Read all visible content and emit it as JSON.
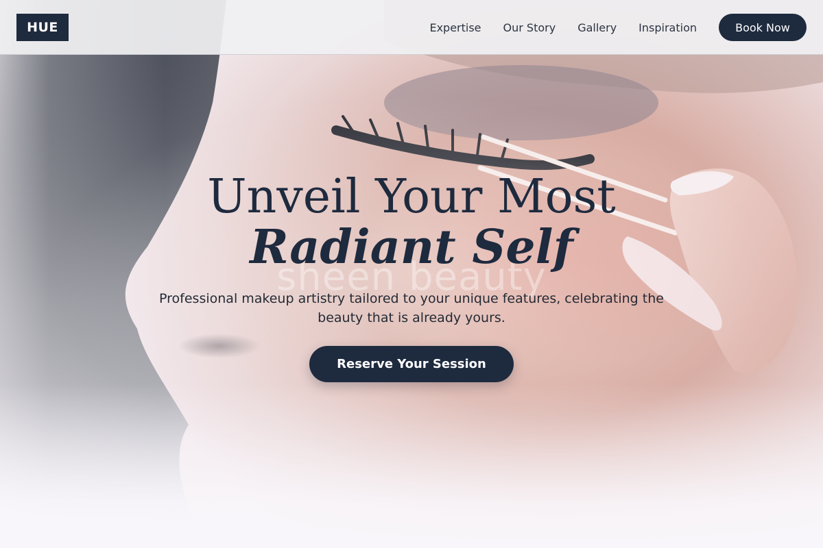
{
  "header": {
    "logo_text": "HUE",
    "nav": [
      "Expertise",
      "Our Story",
      "Gallery",
      "Inspiration"
    ],
    "book_label": "Book Now"
  },
  "hero": {
    "headline_line1": "Unveil Your Most",
    "headline_line2": "Radiant Self",
    "watermark": "sheen beauty",
    "subtitle": "Professional makeup artistry tailored to your unique features, celebrating the beauty that is already yours.",
    "cta_label": "Reserve Your Session",
    "image_description": "close-up profile of a face having false eyelashes applied with tweezers"
  },
  "colors": {
    "brand": "#1e2a3e",
    "text": "#232a35",
    "header_bg": "#f0f0f2"
  }
}
